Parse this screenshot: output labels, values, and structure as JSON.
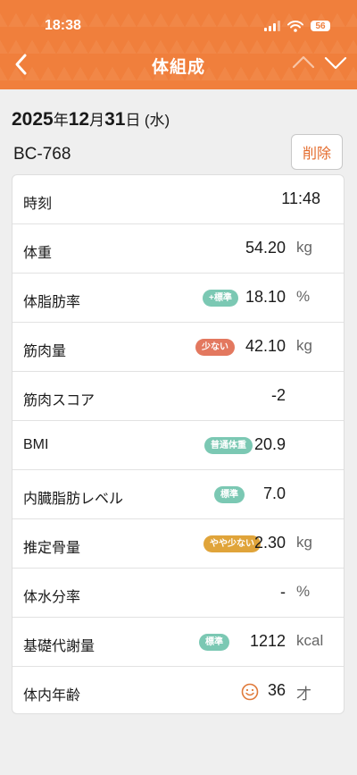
{
  "status": {
    "time": "18:38",
    "battery": "56"
  },
  "header": {
    "title": "体組成"
  },
  "date": {
    "year": "2025",
    "year_suffix": "年",
    "month": "12",
    "month_suffix": "月",
    "day": "31",
    "day_suffix": "日",
    "weekday": "(水)"
  },
  "device": {
    "model": "BC-768"
  },
  "delete_label": "削除",
  "colors": {
    "accent": "#f07f3c",
    "badge_standard": "#7bc8b3",
    "badge_low": "#e3785f",
    "badge_slightly_low": "#e0a43a"
  },
  "rows": {
    "time": {
      "label": "時刻",
      "value": "11:48"
    },
    "weight": {
      "label": "体重",
      "value": "54.20",
      "unit": "kg"
    },
    "body_fat": {
      "label": "体脂肪率",
      "badge": "+標準",
      "value": "18.10",
      "unit": "%"
    },
    "muscle_mass": {
      "label": "筋肉量",
      "badge": "少ない",
      "value": "42.10",
      "unit": "kg"
    },
    "muscle_score": {
      "label": "筋肉スコア",
      "value": "-2"
    },
    "bmi": {
      "label": "BMI",
      "badge": "普通体重",
      "value": "20.9"
    },
    "visceral_fat": {
      "label": "内臓脂肪レベル",
      "badge": "標準",
      "value": "7.0"
    },
    "bone_mass": {
      "label": "推定骨量",
      "badge": "やや少ない",
      "value": "2.30",
      "unit": "kg"
    },
    "body_water": {
      "label": "体水分率",
      "value": "-",
      "unit": "%"
    },
    "bmr": {
      "label": "基礎代謝量",
      "badge": "標準",
      "value": "1212",
      "unit": "kcal"
    },
    "body_age": {
      "label": "体内年齢",
      "icon": "smiley-face-icon",
      "value": "36",
      "unit": "才"
    }
  }
}
